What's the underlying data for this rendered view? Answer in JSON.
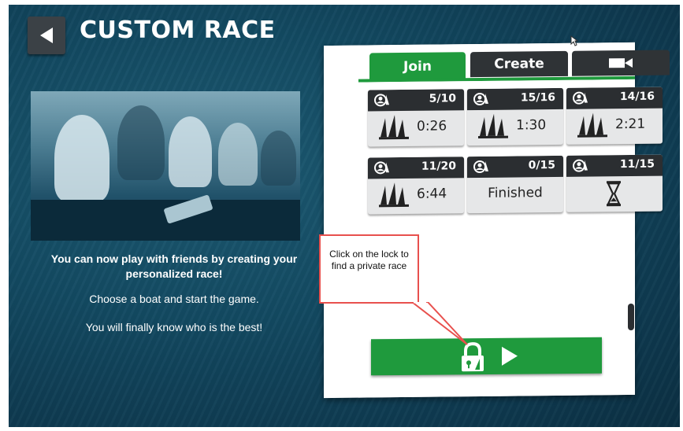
{
  "header": {
    "title": "CUSTOM RACE"
  },
  "intro": {
    "line1": "You can now play with friends by creating your personalized race!",
    "line2": "Choose a boat and start the game.",
    "line3": "You will finally know who is the best!"
  },
  "tabs": [
    {
      "label": "Join",
      "active": true
    },
    {
      "label": "Create",
      "active": false
    },
    {
      "label": "",
      "icon": "camera-icon",
      "active": false
    }
  ],
  "races": [
    {
      "players": "5/10",
      "status": "0:26"
    },
    {
      "players": "15/16",
      "status": "1:30"
    },
    {
      "players": "14/16",
      "status": "2:21"
    },
    {
      "players": "11/20",
      "status": "6:44"
    },
    {
      "players": "0/15",
      "status": "Finished"
    },
    {
      "players": "11/15",
      "status": "",
      "icon": "hourglass-icon"
    }
  ],
  "callout": {
    "text": "Click on the lock to find a private race"
  },
  "colors": {
    "accent": "#1f9a3d",
    "dark": "#2b2e31",
    "callout_border": "#e8504d"
  }
}
